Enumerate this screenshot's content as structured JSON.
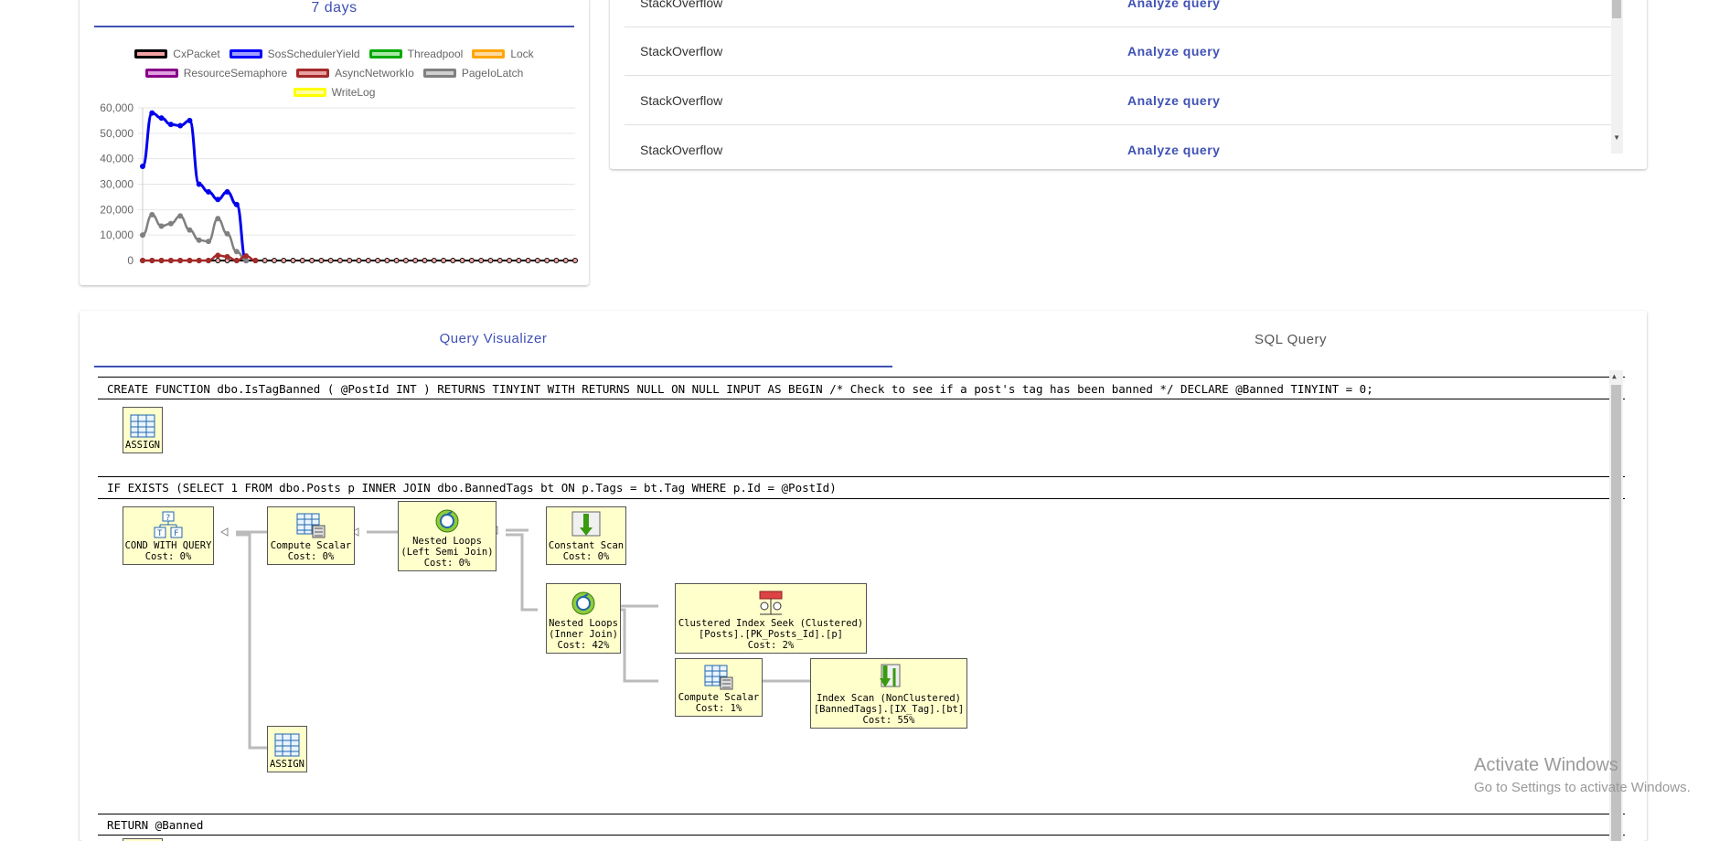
{
  "wait_card": {
    "tab_label": "7 days",
    "legend": [
      {
        "name": "CxPacket",
        "color": "#f4a4a4",
        "border": "#000000"
      },
      {
        "name": "SosSchedulerYield",
        "color": "#a0a0ff",
        "border": "#0000ff"
      },
      {
        "name": "Threadpool",
        "color": "#a8e8a8",
        "border": "#00aa00"
      },
      {
        "name": "Lock",
        "color": "#ffd9a0",
        "border": "#ffa500"
      },
      {
        "name": "ResourceSemaphore",
        "color": "#e0a0e0",
        "border": "#880088"
      },
      {
        "name": "AsyncNetworkIo",
        "color": "#e8a0a0",
        "border": "#a52a2a"
      },
      {
        "name": "PageIoLatch",
        "color": "#d0d0d0",
        "border": "#808080"
      },
      {
        "name": "WriteLog",
        "color": "#ffffa0",
        "border": "#ffff00"
      }
    ]
  },
  "chart_data": {
    "type": "line",
    "yticks": [
      "60,000",
      "50,000",
      "40,000",
      "30,000",
      "20,000",
      "10,000",
      "0"
    ],
    "ylim": [
      0,
      60000
    ],
    "n_points": 47,
    "grid": true,
    "series": [
      {
        "name": "SosSchedulerYield",
        "color": "#0000ee",
        "values": [
          37000,
          58000,
          56000,
          53500,
          53000,
          55000,
          30000,
          27000,
          24000,
          27000,
          22000,
          0
        ]
      },
      {
        "name": "PageIoLatch",
        "color": "#808080",
        "values": [
          10000,
          18000,
          13500,
          14500,
          17500,
          12000,
          8000,
          7500,
          16500,
          10500,
          3500,
          0
        ]
      },
      {
        "name": "AsyncNetworkIo",
        "color": "#a52a2a",
        "values": [
          0,
          0,
          0,
          0,
          0,
          0,
          0,
          0,
          2000,
          1500,
          0,
          1800,
          0
        ]
      },
      {
        "name": "CxPacket",
        "color": "#000000",
        "values": [
          0
        ]
      }
    ]
  },
  "query_list": {
    "rows": [
      {
        "db": "StackOverflow",
        "action": "Analyze query"
      },
      {
        "db": "StackOverflow",
        "action": "Analyze query"
      },
      {
        "db": "StackOverflow",
        "action": "Analyze query"
      },
      {
        "db": "StackOverflow",
        "action": "Analyze query"
      }
    ]
  },
  "visualizer": {
    "tabs": {
      "visualizer": "Query Visualizer",
      "sql": "SQL Query"
    },
    "statements": [
      "CREATE FUNCTION dbo.IsTagBanned ( @PostId INT ) RETURNS TINYINT WITH RETURNS NULL ON NULL INPUT AS BEGIN /* Check to see if a post's tag has been banned */ DECLARE @Banned TINYINT = 0;",
      "IF EXISTS (SELECT 1 FROM dbo.Posts p INNER JOIN dbo.BannedTags bt ON p.Tags = bt.Tag WHERE p.Id = @PostId)",
      "RETURN @Banned"
    ],
    "nodes": {
      "assign1": [
        "ASSIGN"
      ],
      "cond": [
        "COND WITH QUERY",
        "Cost: 0%"
      ],
      "compute1": [
        "Compute Scalar",
        "Cost: 0%"
      ],
      "nested1": [
        "Nested Loops",
        "(Left Semi Join)",
        "Cost: 0%"
      ],
      "constant": [
        "Constant Scan",
        "Cost: 0%"
      ],
      "nested2": [
        "Nested Loops",
        "(Inner Join)",
        "Cost: 42%"
      ],
      "seek": [
        "Clustered Index Seek (Clustered)",
        "[Posts].[PK_Posts_Id].[p]",
        "Cost: 2%"
      ],
      "compute2": [
        "Compute Scalar",
        "Cost: 1%"
      ],
      "scan": [
        "Index Scan (NonClustered)",
        "[BannedTags].[IX_Tag].[bt]",
        "Cost: 55%"
      ],
      "assign2": [
        "ASSIGN"
      ]
    }
  },
  "watermark": {
    "title": "Activate Windows",
    "subtitle": "Go to Settings to activate Windows."
  }
}
